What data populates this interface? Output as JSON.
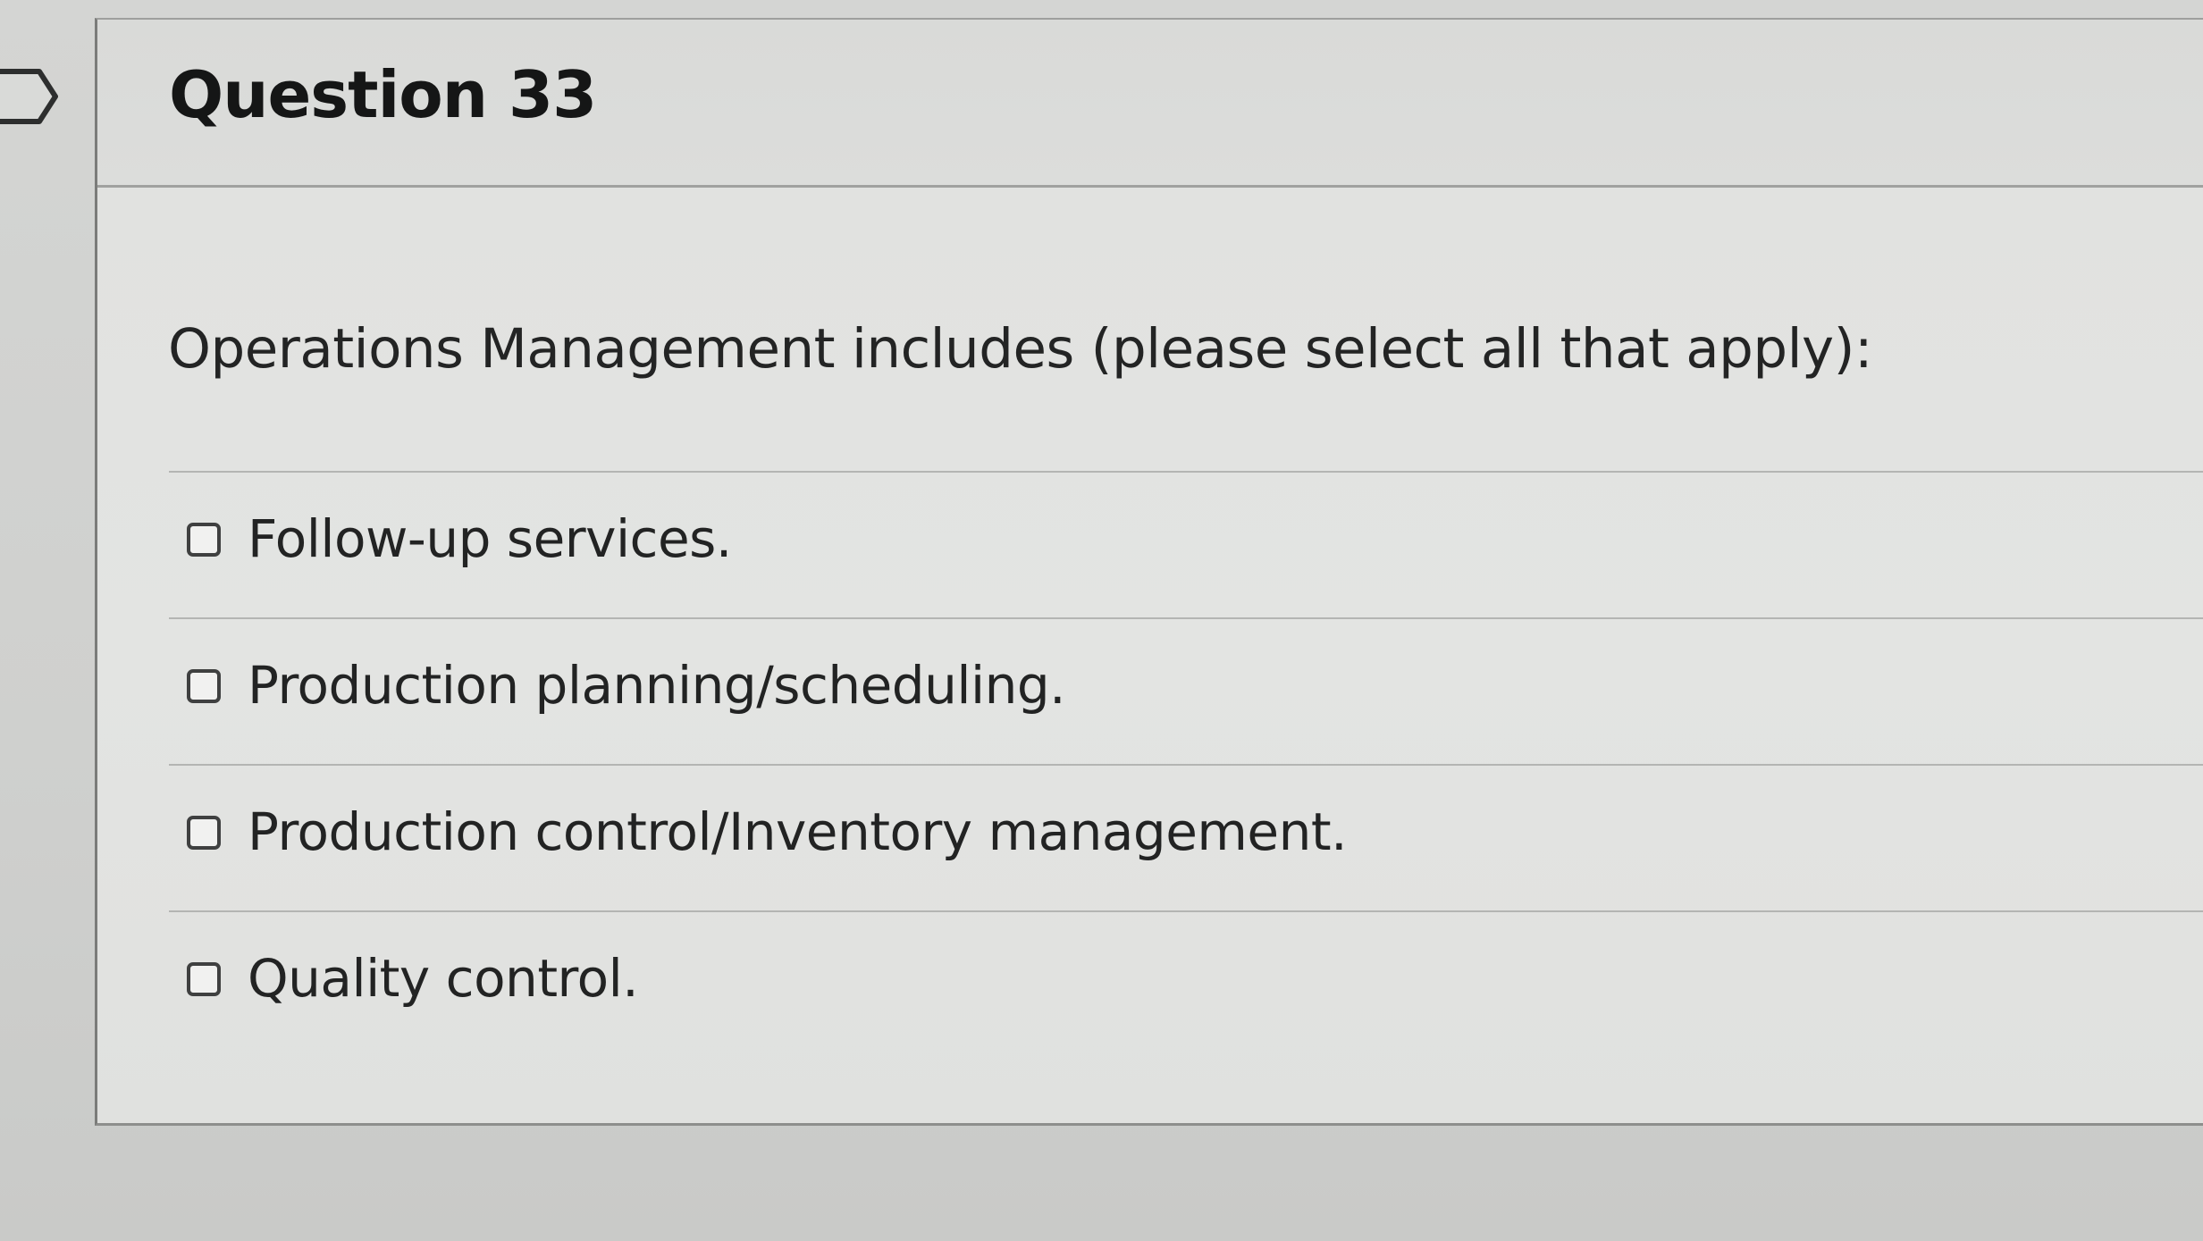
{
  "question": {
    "title": "Question 33",
    "prompt": "Operations Management includes (please select all that apply):",
    "options": [
      {
        "label": "Follow-up services.",
        "checked": false
      },
      {
        "label": "Production planning/scheduling.",
        "checked": false
      },
      {
        "label": "Production control/Inventory management.",
        "checked": false
      },
      {
        "label": "Quality control.",
        "checked": false
      }
    ]
  },
  "colors": {
    "background": "#d4d5d3",
    "card_background": "#e1e2e0",
    "text": "#222323",
    "divider": "#b4b5b3",
    "checkbox_border": "#3f4040"
  }
}
